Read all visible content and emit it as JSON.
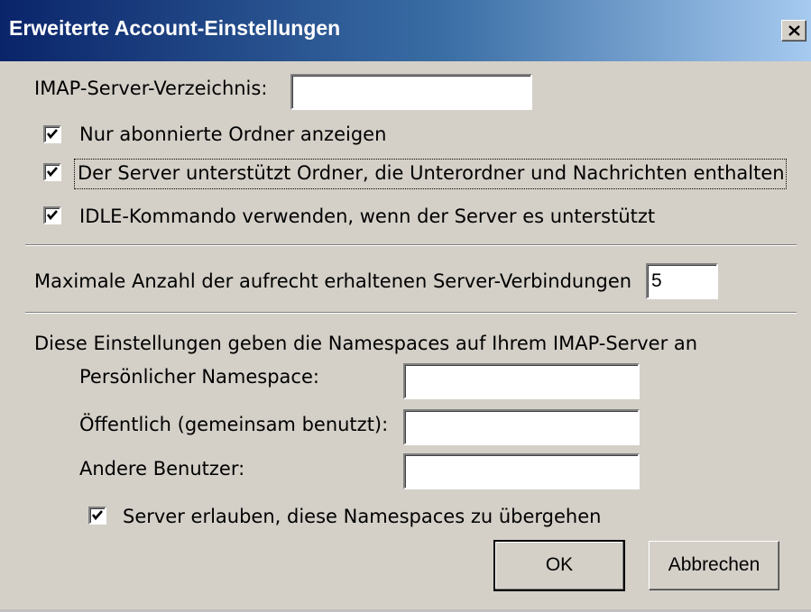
{
  "window": {
    "title": "Erweiterte Account-Einstellungen"
  },
  "imap_dir": {
    "label": "IMAP-Server-Verzeichnis:",
    "value": ""
  },
  "options": {
    "subscribed_only": {
      "label": "Nur abonnierte Ordner anzeigen",
      "checked": true
    },
    "mixed_folders": {
      "label": "Der Server unterstützt Ordner, die Unterordner und Nachrichten enthalten",
      "checked": true
    },
    "idle": {
      "label": "IDLE-Kommando verwenden, wenn der Server es unterstützt",
      "checked": true
    }
  },
  "connections": {
    "label": "Maximale Anzahl der aufrecht erhaltenen Server-Verbindungen",
    "value": "5"
  },
  "namespaces": {
    "intro": "Diese Einstellungen geben die Namespaces auf Ihrem IMAP-Server an",
    "personal": {
      "label": "Persönlicher Namespace:",
      "value": ""
    },
    "public": {
      "label": "Öffentlich (gemeinsam benutzt):",
      "value": ""
    },
    "other_users": {
      "label": "Andere Benutzer:",
      "value": ""
    },
    "allow_override": {
      "label": "Server erlauben, diese Namespaces zu übergehen",
      "checked": true
    }
  },
  "buttons": {
    "ok": "OK",
    "cancel": "Abbrechen"
  },
  "colors": {
    "title_start": "#0a246a",
    "title_end": "#a6caf0",
    "face": "#d4d0c8"
  }
}
